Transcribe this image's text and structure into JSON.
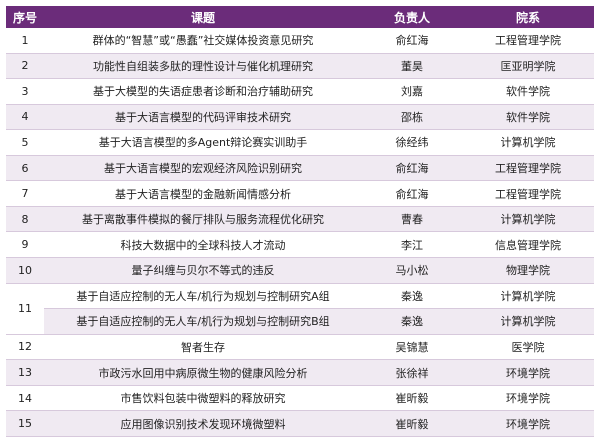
{
  "header": {
    "no": "序号",
    "title": "课题",
    "leader": "负责人",
    "school": "院系"
  },
  "rows": [
    {
      "no": "1",
      "title": "群体的“智慧”或“愚蠢”社交媒体投资意见研究",
      "leader": "俞红海",
      "school": "工程管理学院"
    },
    {
      "no": "2",
      "title": "功能性自组装多肽的理性设计与催化机理研究",
      "leader": "董昊",
      "school": "匡亚明学院"
    },
    {
      "no": "3",
      "title": "基于大模型的失语症患者诊断和治疗辅助研究",
      "leader": "刘嘉",
      "school": "软件学院"
    },
    {
      "no": "4",
      "title": "基于大语言模型的代码评审技术研究",
      "leader": "邵栋",
      "school": "软件学院"
    },
    {
      "no": "5",
      "title": "基于大语言模型的多Agent辩论赛实训助手",
      "leader": "徐经纬",
      "school": "计算机学院"
    },
    {
      "no": "6",
      "title": "基于大语言模型的宏观经济风险识别研究",
      "leader": "俞红海",
      "school": "工程管理学院"
    },
    {
      "no": "7",
      "title": "基于大语言模型的金融新闻情感分析",
      "leader": "俞红海",
      "school": "工程管理学院"
    },
    {
      "no": "8",
      "title": "基于离散事件模拟的餐厅排队与服务流程优化研究",
      "leader": "曹春",
      "school": "计算机学院"
    },
    {
      "no": "9",
      "title": "科技大数据中的全球科技人才流动",
      "leader": "李江",
      "school": "信息管理学院"
    },
    {
      "no": "10",
      "title": "量子纠缠与贝尔不等式的违反",
      "leader": "马小松",
      "school": "物理学院"
    },
    {
      "no": "11",
      "title": "基于自适应控制的无人车/机行为规划与控制研究A组",
      "leader": "秦逸",
      "school": "计算机学院"
    },
    {
      "no": "",
      "title": "基于自适应控制的无人车/机行为规划与控制研究B组",
      "leader": "秦逸",
      "school": "计算机学院"
    },
    {
      "no": "12",
      "title": "智者生存",
      "leader": "吴锦慧",
      "school": "医学院"
    },
    {
      "no": "13",
      "title": "市政污水回用中病原微生物的健康风险分析",
      "leader": "张徐祥",
      "school": "环境学院"
    },
    {
      "no": "14",
      "title": "市售饮料包装中微塑料的释放研究",
      "leader": "崔昕毅",
      "school": "环境学院"
    },
    {
      "no": "15",
      "title": "应用图像识别技术发现环境微塑料",
      "leader": "崔昕毅",
      "school": "环境学院"
    }
  ]
}
